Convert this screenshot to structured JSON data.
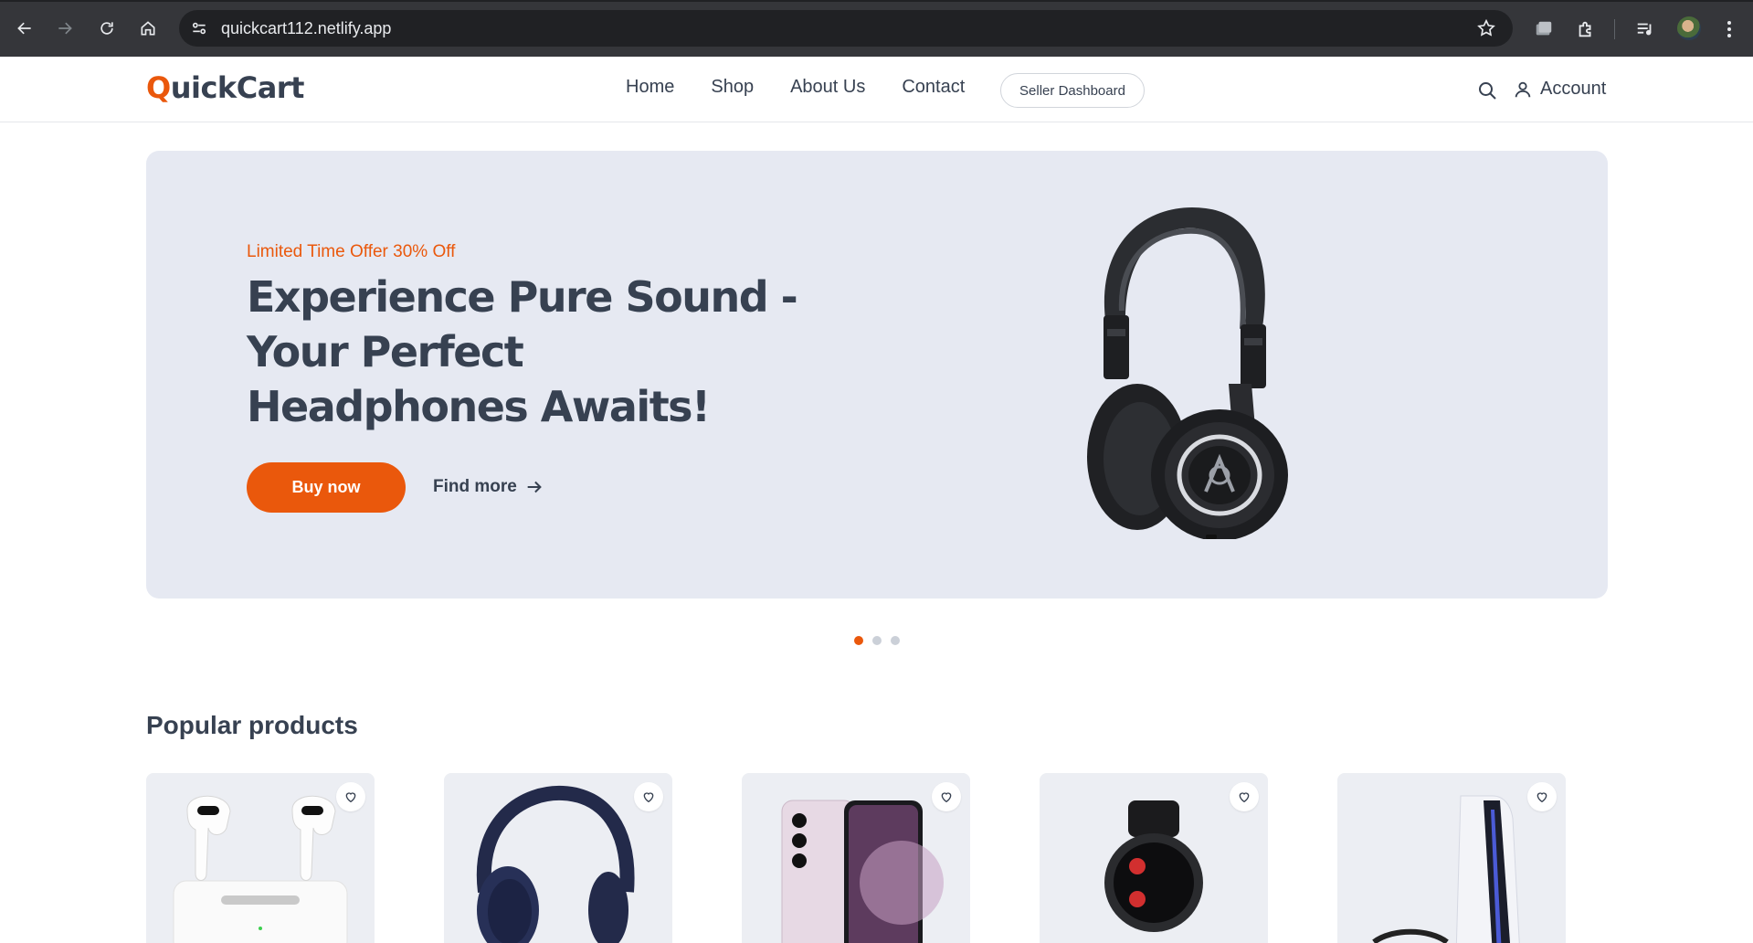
{
  "browser": {
    "url": "quickcart112.netlify.app"
  },
  "header": {
    "logo_first": "Q",
    "logo_rest": "uickCart",
    "nav": [
      "Home",
      "Shop",
      "About Us",
      "Contact"
    ],
    "seller_dashboard": "Seller Dashboard",
    "account": "Account"
  },
  "hero": {
    "offer": "Limited Time Offer 30% Off",
    "headline": "Experience Pure Sound - Your Perfect Headphones Awaits!",
    "buy_now": "Buy now",
    "find_more": "Find more",
    "slides": 3,
    "active_slide": 1
  },
  "popular": {
    "title": "Popular products",
    "products": [
      {
        "icon": "earbuds-image"
      },
      {
        "icon": "headphones-image"
      },
      {
        "icon": "smartphone-image"
      },
      {
        "icon": "smartwatch-image"
      },
      {
        "icon": "game-console-image"
      }
    ]
  },
  "colors": {
    "accent": "#ea580c",
    "hero_bg": "#e6e9f2",
    "text": "#374151",
    "chrome": "#35363a"
  }
}
